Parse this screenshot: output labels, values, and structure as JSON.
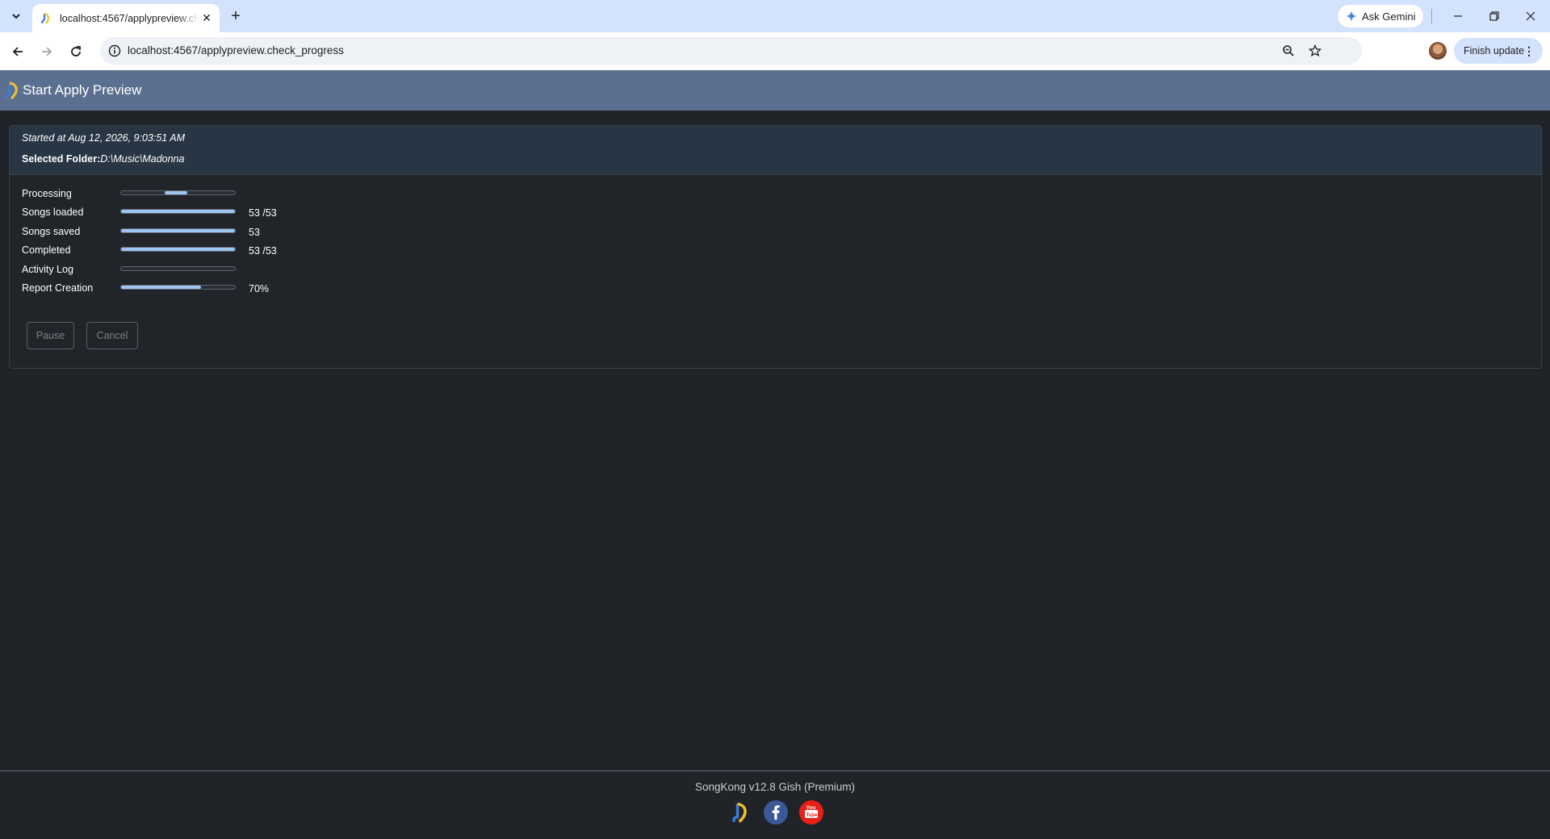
{
  "browser": {
    "tab_title": "localhost:4567/applypreview.check_progress",
    "url": "localhost:4567/applypreview.check_progress",
    "gemini_label": "Ask Gemini",
    "finish_update_label": "Finish update"
  },
  "app": {
    "title": "Start Apply Preview",
    "started_text": "Started at Aug 12, 2026, 9:03:51 AM",
    "folder_label": "Selected Folder:",
    "folder_value": "D:\\Music\\Madonna",
    "progress": [
      {
        "label": "Processing",
        "value": "",
        "fraction": null
      },
      {
        "label": "Songs loaded",
        "value": "53 /53",
        "fraction": 1.0
      },
      {
        "label": "Songs saved",
        "value": "53",
        "fraction": 1.0
      },
      {
        "label": "Completed",
        "value": "53 /53",
        "fraction": 1.0
      },
      {
        "label": "Activity Log",
        "value": "",
        "fraction": 0
      },
      {
        "label": "Report Creation",
        "value": "70%",
        "fraction": 0.7
      }
    ],
    "pause_label": "Pause",
    "cancel_label": "Cancel"
  },
  "footer": {
    "version_text": "SongKong v12.8 Gish (Premium)",
    "icons": [
      "songkong-logo-icon",
      "facebook-icon",
      "youtube-icon"
    ]
  },
  "colors": {
    "header_bg": "#5b7090",
    "card_head_bg": "#283544",
    "progress_fill": "#9ec5f0",
    "page_bg": "#202328"
  }
}
